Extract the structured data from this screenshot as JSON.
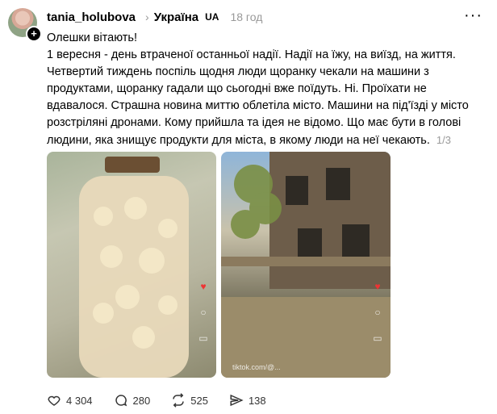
{
  "author": {
    "username": "tania_holubova",
    "topic": "Україна",
    "topic_tag": "UA",
    "time": "18 год"
  },
  "post": {
    "line1": "Олешки вітають!",
    "body": "1 вересня - день втраченої останньої надії. Надії на їжу, на виїзд, на життя. Четвертий тиждень поспіль щодня люди щоранку чекали на машини з продуктами, щоранку гадали що сьогодні вже поїдуть. Ні. Проїхати не вдавалося. Страшна новина миттю облетіла місто. Машини на під'їзді у місто розстріляні дронами. Кому прийшла та ідея не відомо. Що має бути в голові людини, яка знищує продукти для міста, в якому люди на неї чекають.",
    "pager": "1/3"
  },
  "media": [
    {
      "watermark": ""
    },
    {
      "watermark": "tiktok.com/@..."
    }
  ],
  "actions": {
    "likes": "4 304",
    "comments": "280",
    "reposts": "525",
    "shares": "138"
  }
}
